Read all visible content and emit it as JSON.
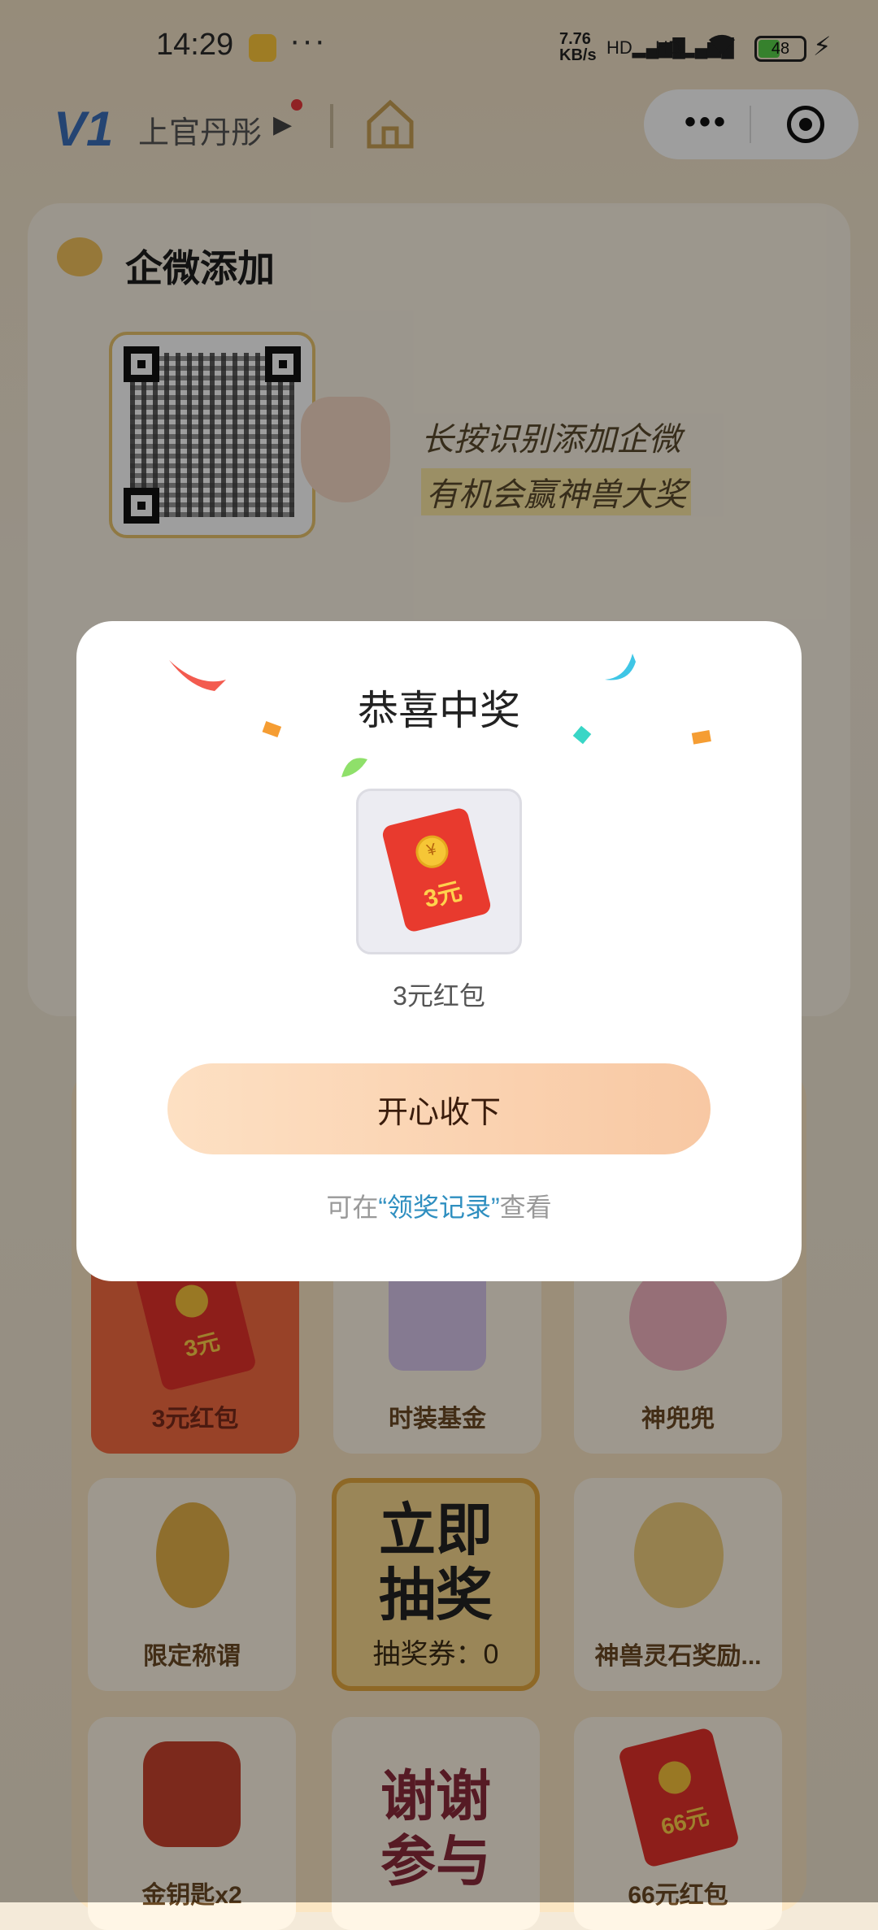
{
  "status_bar": {
    "time": "14:29",
    "more": "···",
    "net_speed_top": "7.76",
    "net_speed_bottom": "KB/s",
    "signal1": "HD▂▄▆█",
    "signal2": "HD▂▄▆█",
    "battery": "48",
    "battery_level": 0.48,
    "battery_color": "#57d14a"
  },
  "nav": {
    "logo": "V1",
    "user_name": "上官丹彤",
    "home_icon": "home-icon",
    "capsule_icons": [
      "more-icon",
      "target-icon"
    ]
  },
  "qr_card": {
    "title": "企微添加",
    "line1": "长按识别添加企微",
    "line2": "有机会赢神兽大奖"
  },
  "prizes": [
    {
      "label": "3元红包",
      "art": "红包",
      "art_text": "3元"
    },
    {
      "label": "时装基金",
      "art": "时装基金"
    },
    {
      "label": "神兜兜",
      "art": "神兜兜"
    },
    {
      "label": "限定称谓",
      "art": "限定称谓"
    },
    {
      "label": "立即\n抽奖",
      "sub": "抽奖券：0"
    },
    {
      "label": "神兽灵石奖励...",
      "art": "灵石蛋"
    },
    {
      "label": "金钥匙x2",
      "art": "宝箱"
    },
    {
      "label": "谢谢\n参与"
    },
    {
      "label": "66元红包",
      "art": "红包",
      "art_text": "66元"
    }
  ],
  "dialog": {
    "title": "恭喜中奖",
    "prize_art_text": "3元",
    "prize_art_symbol": "¥",
    "prize_name": "3元红包",
    "accept_button": "开心收下",
    "record_prefix": "可在",
    "record_link": "“领奖记录”",
    "record_suffix": "查看",
    "accent": "#2f8fc0"
  }
}
